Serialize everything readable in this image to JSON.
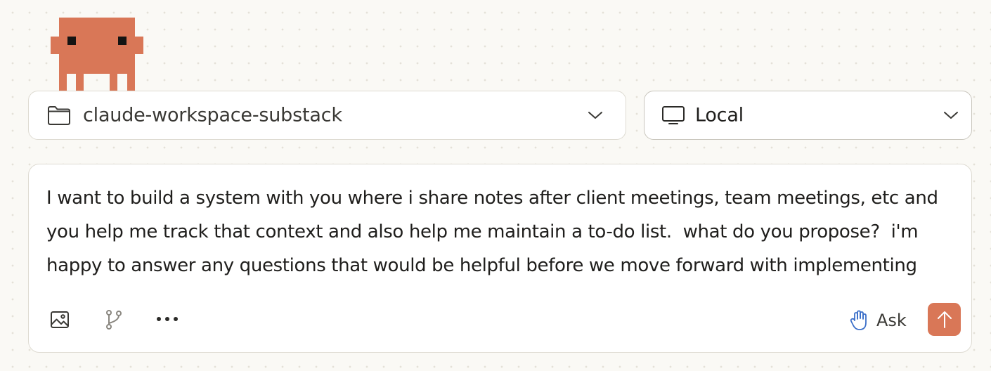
{
  "mascot": {
    "icon": "pixel-creature-icon",
    "color": "#d97757"
  },
  "project_selector": {
    "icon": "folder-icon",
    "value": "claude-workspace-substack",
    "chevron_icon": "chevron-down-icon"
  },
  "environment_selector": {
    "icon": "monitor-icon",
    "value": "Local",
    "chevron_icon": "chevron-down-icon"
  },
  "composer": {
    "text": "I want to build a system with you where i share notes after client meetings, team meetings, etc and you help me track that context and also help me maintain a to-do list.  what do you propose?  i'm happy to answer any questions that would be helpful before we move forward with implementing",
    "toolbar": {
      "attach_image_icon": "image-icon",
      "branch_icon": "git-branch-icon",
      "more_icon": "more-horizontal-icon"
    },
    "mode": {
      "icon": "hand-icon",
      "label": "Ask"
    },
    "send": {
      "icon": "arrow-up-icon",
      "color": "#d97757"
    }
  }
}
